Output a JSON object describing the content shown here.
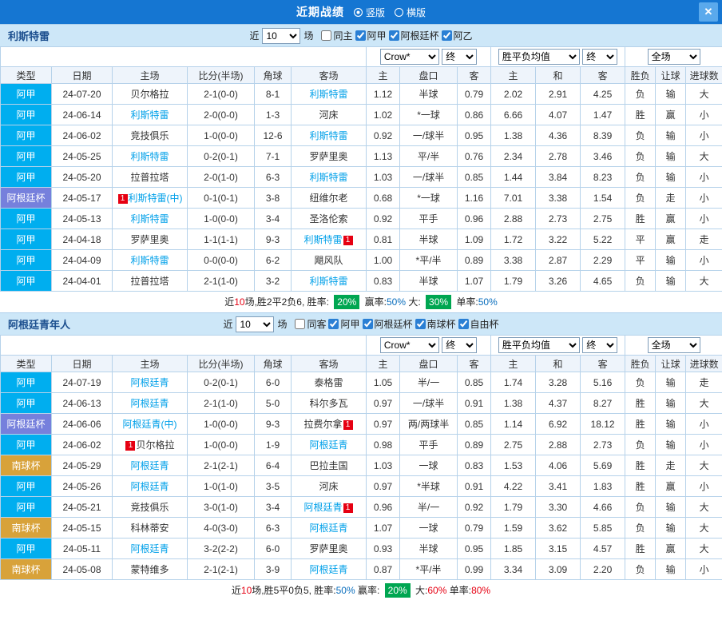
{
  "topbar": {
    "title": "近期战绩",
    "layout_options": [
      {
        "label": "竖版",
        "selected": true
      },
      {
        "label": "横版",
        "selected": false
      }
    ],
    "close_glyph": "✕"
  },
  "colors": {
    "topbar": "#1576d2",
    "section_header": "#cde7f8",
    "border": "#b6d2ea",
    "red": "#e60012",
    "green": "#00a050",
    "blue": "#0a6ebd",
    "focal_team": "#00a0e9",
    "badge_green": "#00a651",
    "league": {
      "阿甲": "#00aeef",
      "阿根廷杯": "#7680dc",
      "南球杯": "#d8a23a"
    }
  },
  "columns": [
    "类型",
    "日期",
    "主场",
    "比分(半场)",
    "角球",
    "客场",
    "主",
    "盘口",
    "客",
    "主",
    "和",
    "客",
    "胜负",
    "让球",
    "进球数"
  ],
  "sections": [
    {
      "team": "利斯特雷",
      "near_label": "近",
      "games_count": "10",
      "games_label": "场",
      "checkboxes": [
        {
          "label": "同主",
          "checked": false
        },
        {
          "label": "阿甲",
          "checked": true
        },
        {
          "label": "阿根廷杯",
          "checked": true
        },
        {
          "label": "阿乙",
          "checked": true
        }
      ],
      "selects": {
        "company": "Crow*",
        "company_time": "终",
        "avg": "胜平负均值",
        "avg_time": "终",
        "scope": "全场"
      },
      "rows": [
        {
          "type": "阿甲",
          "date": "24-07-20",
          "home": {
            "name": "贝尔格拉",
            "focal": false
          },
          "score": "2-1(0-0)",
          "corner": "8-1",
          "away": {
            "name": "利斯特雷",
            "focal": true
          },
          "odds": [
            "1.12",
            "半球",
            "0.79"
          ],
          "avg": [
            "2.02",
            "2.91",
            "4.25"
          ],
          "res": [
            {
              "t": "负",
              "c": "green"
            },
            {
              "t": "输",
              "c": "green"
            },
            {
              "t": "大",
              "c": "red"
            }
          ]
        },
        {
          "type": "阿甲",
          "date": "24-06-14",
          "home": {
            "name": "利斯特雷",
            "focal": true
          },
          "score": "2-0(0-0)",
          "corner": "1-3",
          "away": {
            "name": "河床",
            "focal": false
          },
          "odds": [
            "1.02",
            "*一球",
            "0.86"
          ],
          "avg": [
            "6.66",
            "4.07",
            "1.47"
          ],
          "res": [
            {
              "t": "胜",
              "c": "red"
            },
            {
              "t": "赢",
              "c": "red"
            },
            {
              "t": "小",
              "c": "green"
            }
          ]
        },
        {
          "type": "阿甲",
          "date": "24-06-02",
          "home": {
            "name": "竞技俱乐",
            "focal": false
          },
          "score": "1-0(0-0)",
          "corner": "12-6",
          "away": {
            "name": "利斯特雷",
            "focal": true
          },
          "odds": [
            "0.92",
            "一/球半",
            "0.95"
          ],
          "avg": [
            "1.38",
            "4.36",
            "8.39"
          ],
          "res": [
            {
              "t": "负",
              "c": "green"
            },
            {
              "t": "输",
              "c": "green"
            },
            {
              "t": "小",
              "c": "green"
            }
          ]
        },
        {
          "type": "阿甲",
          "date": "24-05-25",
          "home": {
            "name": "利斯特雷",
            "focal": true
          },
          "score": "0-2(0-1)",
          "corner": "7-1",
          "away": {
            "name": "罗萨里奥",
            "focal": false
          },
          "odds": [
            "1.13",
            "平/半",
            "0.76"
          ],
          "avg": [
            "2.34",
            "2.78",
            "3.46"
          ],
          "res": [
            {
              "t": "负",
              "c": "green"
            },
            {
              "t": "输",
              "c": "green"
            },
            {
              "t": "大",
              "c": "red"
            }
          ]
        },
        {
          "type": "阿甲",
          "date": "24-05-20",
          "home": {
            "name": "拉普拉塔",
            "focal": false
          },
          "score": "2-0(1-0)",
          "corner": "6-3",
          "away": {
            "name": "利斯特雷",
            "focal": true
          },
          "odds": [
            "1.03",
            "一/球半",
            "0.85"
          ],
          "avg": [
            "1.44",
            "3.84",
            "8.23"
          ],
          "res": [
            {
              "t": "负",
              "c": "green"
            },
            {
              "t": "输",
              "c": "green"
            },
            {
              "t": "小",
              "c": "green"
            }
          ]
        },
        {
          "type": "阿根廷杯",
          "date": "24-05-17",
          "home": {
            "name": "利斯特雷(中)",
            "focal": true,
            "badge": {
              "pos": "before",
              "text": "1"
            }
          },
          "score": "0-1(0-1)",
          "corner": "3-8",
          "away": {
            "name": "纽维尔老",
            "focal": false
          },
          "odds": [
            "0.68",
            "*一球",
            "1.16"
          ],
          "avg": [
            "7.01",
            "3.38",
            "1.54"
          ],
          "res": [
            {
              "t": "负",
              "c": "green"
            },
            {
              "t": "走",
              "c": "blue"
            },
            {
              "t": "小",
              "c": "green"
            }
          ]
        },
        {
          "type": "阿甲",
          "date": "24-05-13",
          "home": {
            "name": "利斯特雷",
            "focal": true
          },
          "score": "1-0(0-0)",
          "corner": "3-4",
          "away": {
            "name": "圣洛伦索",
            "focal": false
          },
          "odds": [
            "0.92",
            "平手",
            "0.96"
          ],
          "avg": [
            "2.88",
            "2.73",
            "2.75"
          ],
          "res": [
            {
              "t": "胜",
              "c": "red"
            },
            {
              "t": "赢",
              "c": "red"
            },
            {
              "t": "小",
              "c": "green"
            }
          ]
        },
        {
          "type": "阿甲",
          "date": "24-04-18",
          "home": {
            "name": "罗萨里奥",
            "focal": false
          },
          "score": "1-1(1-1)",
          "corner": "9-3",
          "away": {
            "name": "利斯特雷",
            "focal": true,
            "badge": {
              "pos": "after",
              "text": "1"
            }
          },
          "odds": [
            "0.81",
            "半球",
            "1.09"
          ],
          "avg": [
            "1.72",
            "3.22",
            "5.22"
          ],
          "res": [
            {
              "t": "平",
              "c": "blue"
            },
            {
              "t": "赢",
              "c": "red"
            },
            {
              "t": "走",
              "c": "blue"
            }
          ]
        },
        {
          "type": "阿甲",
          "date": "24-04-09",
          "home": {
            "name": "利斯特雷",
            "focal": true
          },
          "score": "0-0(0-0)",
          "corner": "6-2",
          "away": {
            "name": "飓风队",
            "focal": false
          },
          "odds": [
            "1.00",
            "*平/半",
            "0.89"
          ],
          "avg": [
            "3.38",
            "2.87",
            "2.29"
          ],
          "res": [
            {
              "t": "平",
              "c": "blue"
            },
            {
              "t": "输",
              "c": "green"
            },
            {
              "t": "小",
              "c": "green"
            }
          ]
        },
        {
          "type": "阿甲",
          "date": "24-04-01",
          "home": {
            "name": "拉普拉塔",
            "focal": false
          },
          "score": "2-1(1-0)",
          "corner": "3-2",
          "away": {
            "name": "利斯特雷",
            "focal": true
          },
          "odds": [
            "0.83",
            "半球",
            "1.07"
          ],
          "avg": [
            "1.79",
            "3.26",
            "4.65"
          ],
          "res": [
            {
              "t": "负",
              "c": "green"
            },
            {
              "t": "输",
              "c": "green"
            },
            {
              "t": "大",
              "c": "red"
            }
          ]
        }
      ],
      "summary": [
        {
          "t": "近",
          "c": "black"
        },
        {
          "t": "10",
          "c": "red"
        },
        {
          "t": "场,胜2平2负6, 胜率: ",
          "c": "black"
        },
        {
          "t": "20%",
          "c": "badge"
        },
        {
          "t": " 赢率:",
          "c": "black"
        },
        {
          "t": "50%",
          "c": "blue"
        },
        {
          "t": " 大: ",
          "c": "black"
        },
        {
          "t": "30%",
          "c": "badge"
        },
        {
          "t": " 单率:",
          "c": "black"
        },
        {
          "t": "50%",
          "c": "blue"
        }
      ]
    },
    {
      "team": "阿根廷青年人",
      "near_label": "近",
      "games_count": "10",
      "games_label": "场",
      "checkboxes": [
        {
          "label": "同客",
          "checked": false
        },
        {
          "label": "阿甲",
          "checked": true
        },
        {
          "label": "阿根廷杯",
          "checked": true
        },
        {
          "label": "南球杯",
          "checked": true
        },
        {
          "label": "自由杯",
          "checked": true
        }
      ],
      "selects": {
        "company": "Crow*",
        "company_time": "终",
        "avg": "胜平负均值",
        "avg_time": "终",
        "scope": "全场"
      },
      "rows": [
        {
          "type": "阿甲",
          "date": "24-07-19",
          "home": {
            "name": "阿根廷青",
            "focal": true
          },
          "score": "0-2(0-1)",
          "corner": "6-0",
          "away": {
            "name": "泰格雷",
            "focal": false
          },
          "odds": [
            "1.05",
            "半/一",
            "0.85"
          ],
          "avg": [
            "1.74",
            "3.28",
            "5.16"
          ],
          "res": [
            {
              "t": "负",
              "c": "green"
            },
            {
              "t": "输",
              "c": "green"
            },
            {
              "t": "走",
              "c": "blue"
            }
          ]
        },
        {
          "type": "阿甲",
          "date": "24-06-13",
          "home": {
            "name": "阿根廷青",
            "focal": true
          },
          "score": "2-1(1-0)",
          "corner": "5-0",
          "away": {
            "name": "科尔多瓦",
            "focal": false
          },
          "odds": [
            "0.97",
            "一/球半",
            "0.91"
          ],
          "avg": [
            "1.38",
            "4.37",
            "8.27"
          ],
          "res": [
            {
              "t": "胜",
              "c": "red"
            },
            {
              "t": "输",
              "c": "green"
            },
            {
              "t": "大",
              "c": "red"
            }
          ]
        },
        {
          "type": "阿根廷杯",
          "date": "24-06-06",
          "home": {
            "name": "阿根廷青(中)",
            "focal": true
          },
          "score": "1-0(0-0)",
          "corner": "9-3",
          "away": {
            "name": "拉费尔拿",
            "focal": false,
            "badge": {
              "pos": "after",
              "text": "1"
            }
          },
          "odds": [
            "0.97",
            "两/两球半",
            "0.85"
          ],
          "avg": [
            "1.14",
            "6.92",
            "18.12"
          ],
          "res": [
            {
              "t": "胜",
              "c": "red"
            },
            {
              "t": "输",
              "c": "green"
            },
            {
              "t": "小",
              "c": "green"
            }
          ]
        },
        {
          "type": "阿甲",
          "date": "24-06-02",
          "home": {
            "name": "贝尔格拉",
            "focal": false,
            "badge": {
              "pos": "before",
              "text": "1"
            }
          },
          "score": "1-0(0-0)",
          "corner": "1-9",
          "away": {
            "name": "阿根廷青",
            "focal": true
          },
          "odds": [
            "0.98",
            "平手",
            "0.89"
          ],
          "avg": [
            "2.75",
            "2.88",
            "2.73"
          ],
          "res": [
            {
              "t": "负",
              "c": "green"
            },
            {
              "t": "输",
              "c": "green"
            },
            {
              "t": "小",
              "c": "green"
            }
          ]
        },
        {
          "type": "南球杯",
          "date": "24-05-29",
          "home": {
            "name": "阿根廷青",
            "focal": true
          },
          "score": "2-1(2-1)",
          "corner": "6-4",
          "away": {
            "name": "巴拉圭国",
            "focal": false
          },
          "odds": [
            "1.03",
            "一球",
            "0.83"
          ],
          "avg": [
            "1.53",
            "4.06",
            "5.69"
          ],
          "res": [
            {
              "t": "胜",
              "c": "red"
            },
            {
              "t": "走",
              "c": "blue"
            },
            {
              "t": "大",
              "c": "red"
            }
          ]
        },
        {
          "type": "阿甲",
          "date": "24-05-26",
          "home": {
            "name": "阿根廷青",
            "focal": true
          },
          "score": "1-0(1-0)",
          "corner": "3-5",
          "away": {
            "name": "河床",
            "focal": false
          },
          "odds": [
            "0.97",
            "*半球",
            "0.91"
          ],
          "avg": [
            "4.22",
            "3.41",
            "1.83"
          ],
          "res": [
            {
              "t": "胜",
              "c": "red"
            },
            {
              "t": "赢",
              "c": "red"
            },
            {
              "t": "小",
              "c": "green"
            }
          ]
        },
        {
          "type": "阿甲",
          "date": "24-05-21",
          "home": {
            "name": "竞技俱乐",
            "focal": false
          },
          "score": "3-0(1-0)",
          "corner": "3-4",
          "away": {
            "name": "阿根廷青",
            "focal": true,
            "badge": {
              "pos": "after",
              "text": "1"
            }
          },
          "odds": [
            "0.96",
            "半/一",
            "0.92"
          ],
          "avg": [
            "1.79",
            "3.30",
            "4.66"
          ],
          "res": [
            {
              "t": "负",
              "c": "green"
            },
            {
              "t": "输",
              "c": "green"
            },
            {
              "t": "大",
              "c": "red"
            }
          ]
        },
        {
          "type": "南球杯",
          "date": "24-05-15",
          "home": {
            "name": "科林蒂安",
            "focal": false
          },
          "score": "4-0(3-0)",
          "corner": "6-3",
          "away": {
            "name": "阿根廷青",
            "focal": true
          },
          "odds": [
            "1.07",
            "一球",
            "0.79"
          ],
          "avg": [
            "1.59",
            "3.62",
            "5.85"
          ],
          "res": [
            {
              "t": "负",
              "c": "green"
            },
            {
              "t": "输",
              "c": "green"
            },
            {
              "t": "大",
              "c": "red"
            }
          ]
        },
        {
          "type": "阿甲",
          "date": "24-05-11",
          "home": {
            "name": "阿根廷青",
            "focal": true
          },
          "score": "3-2(2-2)",
          "corner": "6-0",
          "away": {
            "name": "罗萨里奥",
            "focal": false
          },
          "odds": [
            "0.93",
            "半球",
            "0.95"
          ],
          "avg": [
            "1.85",
            "3.15",
            "4.57"
          ],
          "res": [
            {
              "t": "胜",
              "c": "red"
            },
            {
              "t": "赢",
              "c": "red"
            },
            {
              "t": "大",
              "c": "red"
            }
          ]
        },
        {
          "type": "南球杯",
          "date": "24-05-08",
          "home": {
            "name": "蒙特维多",
            "focal": false
          },
          "score": "2-1(2-1)",
          "corner": "3-9",
          "away": {
            "name": "阿根廷青",
            "focal": true
          },
          "odds": [
            "0.87",
            "*平/半",
            "0.99"
          ],
          "avg": [
            "3.34",
            "3.09",
            "2.20"
          ],
          "res": [
            {
              "t": "负",
              "c": "green"
            },
            {
              "t": "输",
              "c": "green"
            },
            {
              "t": "小",
              "c": "green"
            }
          ]
        }
      ],
      "summary": [
        {
          "t": "近",
          "c": "black"
        },
        {
          "t": "10",
          "c": "red"
        },
        {
          "t": "场,胜5平0负5, 胜率:",
          "c": "black"
        },
        {
          "t": "50%",
          "c": "blue"
        },
        {
          "t": " 赢率: ",
          "c": "black"
        },
        {
          "t": "20%",
          "c": "badge"
        },
        {
          "t": " 大:",
          "c": "black"
        },
        {
          "t": "60%",
          "c": "red"
        },
        {
          "t": " 单率:",
          "c": "black"
        },
        {
          "t": "80%",
          "c": "red"
        }
      ]
    }
  ]
}
